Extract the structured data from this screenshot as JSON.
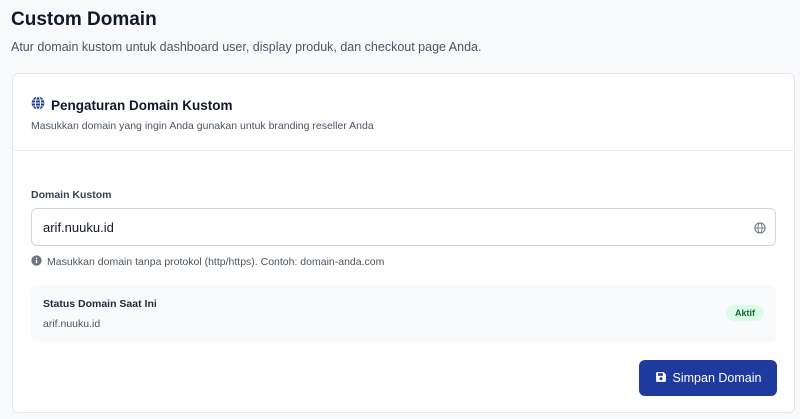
{
  "page": {
    "title": "Custom Domain",
    "subtitle": "Atur domain kustom untuk dashboard user, display produk, dan checkout page Anda."
  },
  "card": {
    "icon": "globe-icon",
    "title": "Pengaturan Domain Kustom",
    "description": "Masukkan domain yang ingin Anda gunakan untuk branding reseller Anda"
  },
  "form": {
    "label": "Domain Kustom",
    "value": "arif.nuuku.id",
    "input_icon": "globe-icon",
    "hint_icon": "info-icon",
    "hint": "Masukkan domain tanpa protokol (http/https). Contoh: domain-anda.com"
  },
  "status": {
    "label": "Status Domain Saat Ini",
    "value": "arif.nuuku.id",
    "badge": "Aktif",
    "badge_color": "#dcfce7",
    "badge_text_color": "#166534"
  },
  "actions": {
    "save_label": "Simpan Domain",
    "save_icon": "save-icon",
    "button_color": "#1e3a9f"
  }
}
